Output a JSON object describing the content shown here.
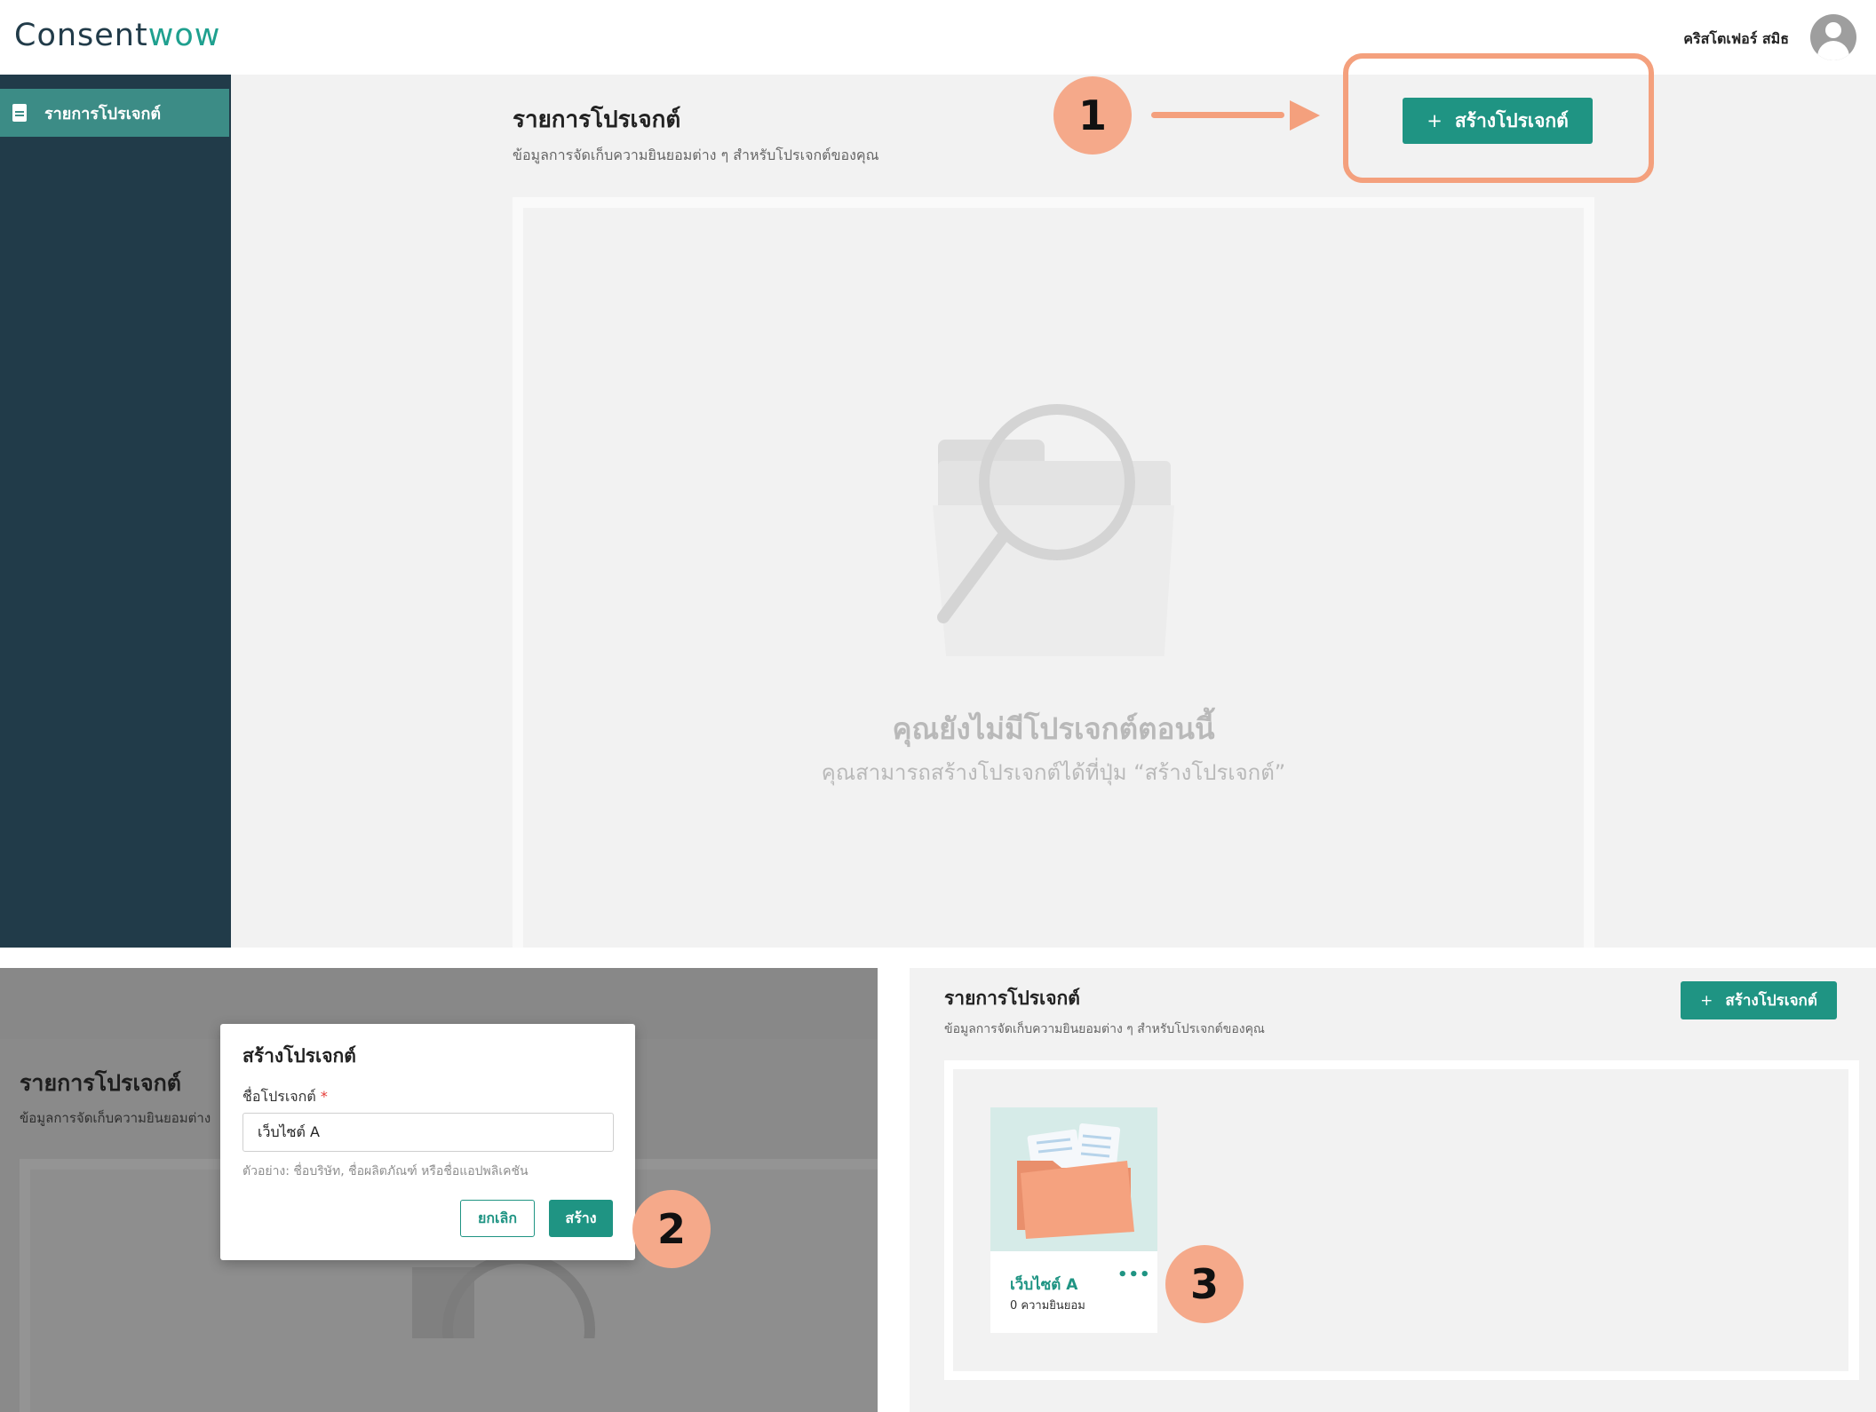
{
  "header": {
    "logo_prefix": "Consent",
    "logo_suffix": "wow",
    "user_name": "คริสโตเฟอร์ สมิธ",
    "avatar_icon": "user-avatar-icon"
  },
  "sidebar": {
    "items": [
      {
        "label": "รายการโปรเจกต์",
        "icon": "document-icon",
        "active": true
      }
    ]
  },
  "main": {
    "title": "รายการโปรเจกต์",
    "subtitle": "ข้อมูลการจัดเก็บความยินยอมต่าง ๆ สำหรับโปรเจกต์ของคุณ",
    "create_button": "สร้างโปรเจกต์",
    "empty_title": "คุณยังไม่มีโปรเจกต์ตอนนี้",
    "empty_subtitle": "คุณสามารถสร้างโปรเจกต์ได้ที่ปุ่ม “สร้างโปรเจกต์”"
  },
  "steps": [
    "1",
    "2",
    "3"
  ],
  "modal": {
    "bg_title": "รายการโปรเจกต์",
    "bg_subtitle": "ข้อมูลการจัดเก็บความยินยอมต่าง",
    "title": "สร้างโปรเจกต์",
    "field_label": "ชื่อโปรเจกต์",
    "required_mark": "*",
    "field_value": "เว็บไซต์ A",
    "hint": "ตัวอย่าง: ชื่อบริษัท, ชื่อผลิตภัณฑ์ หรือชื่อแอปพลิเคชัน",
    "cancel": "ยกเลิก",
    "create": "สร้าง"
  },
  "result": {
    "title": "รายการโปรเจกต์",
    "subtitle": "ข้อมูลการจัดเก็บความยินยอมต่าง ๆ สำหรับโปรเจกต์ของคุณ",
    "create_button": "สร้างโปรเจกต์",
    "project": {
      "name": "เว็บไซต์ A",
      "count": "0 ความยินยอม",
      "more": "•••",
      "thumb_icon": "folder-documents-icon"
    }
  },
  "colors": {
    "accent": "#1f9483",
    "sidebar": "#213b49",
    "sidebar_active": "#3c8c86",
    "annotation": "#f4a07d"
  }
}
